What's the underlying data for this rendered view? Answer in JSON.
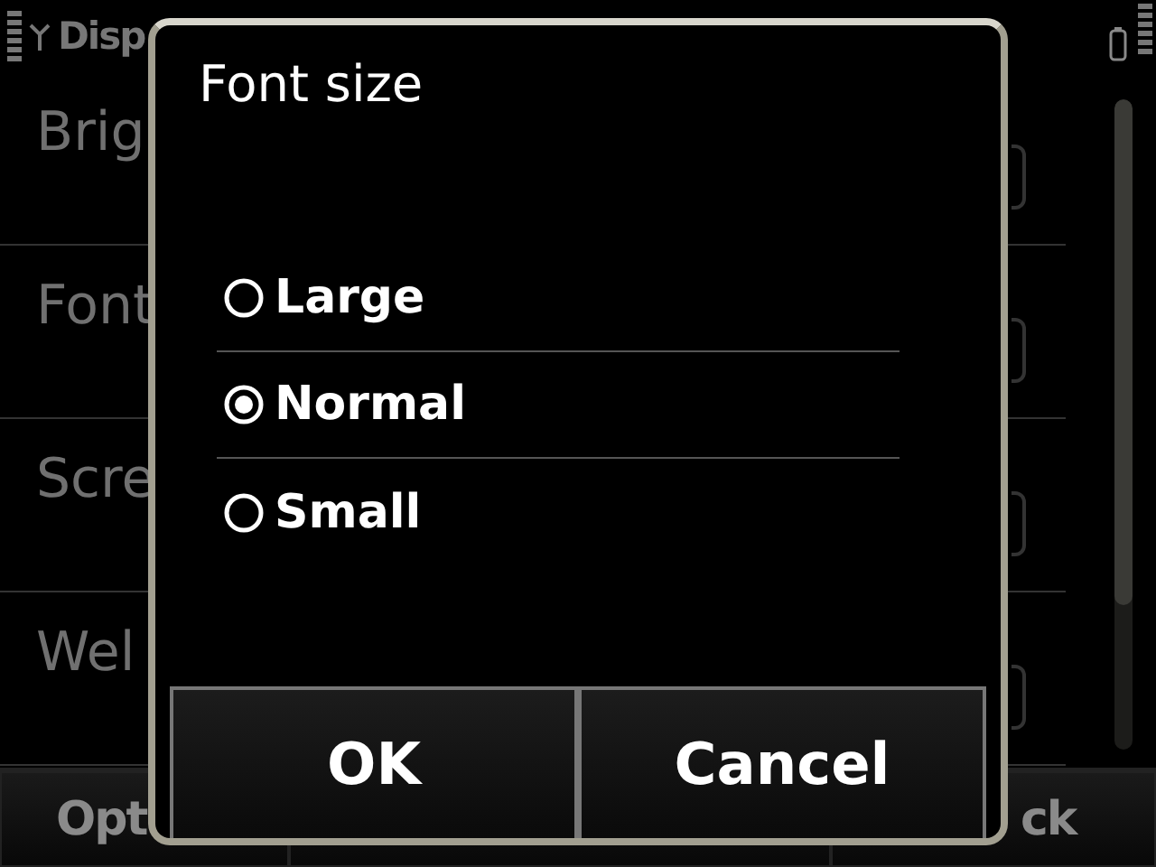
{
  "status_bar": {
    "title": "Disp"
  },
  "settings_list": [
    {
      "label": "Brig"
    },
    {
      "label": "Font"
    },
    {
      "label": "Scre"
    },
    {
      "label": "Wel"
    }
  ],
  "softkeys": {
    "left": "Opt",
    "right": "ck"
  },
  "dialog": {
    "title": "Font size",
    "options": [
      {
        "label": "Large",
        "selected": false
      },
      {
        "label": "Normal",
        "selected": true
      },
      {
        "label": "Small",
        "selected": false
      }
    ],
    "buttons": [
      "OK",
      "Cancel"
    ]
  }
}
